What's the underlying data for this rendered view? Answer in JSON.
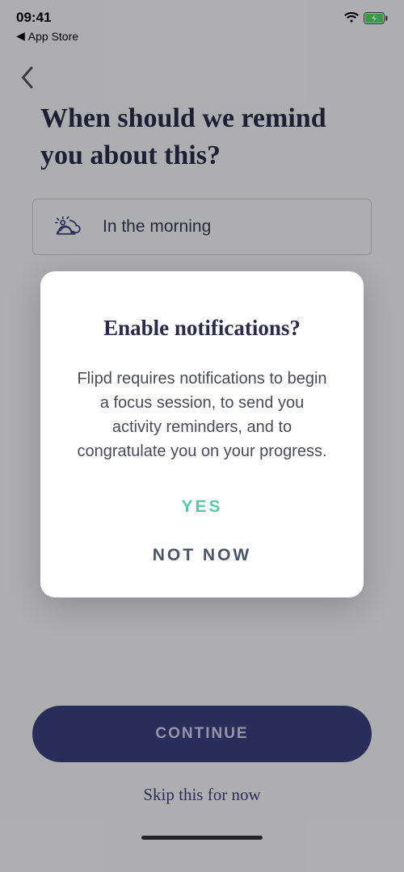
{
  "status": {
    "time": "09:41",
    "back_to_app": "App Store"
  },
  "page": {
    "heading": "When should we remind you about this?",
    "option_label": "In the morning",
    "continue": "CONTINUE",
    "skip": "Skip this for now"
  },
  "modal": {
    "title": "Enable notifications?",
    "body": "Flipd requires notifications to begin a focus session, to send you activity reminders, and to congratulate you on your progress.",
    "yes": "YES",
    "not_now": "NOT NOW"
  }
}
